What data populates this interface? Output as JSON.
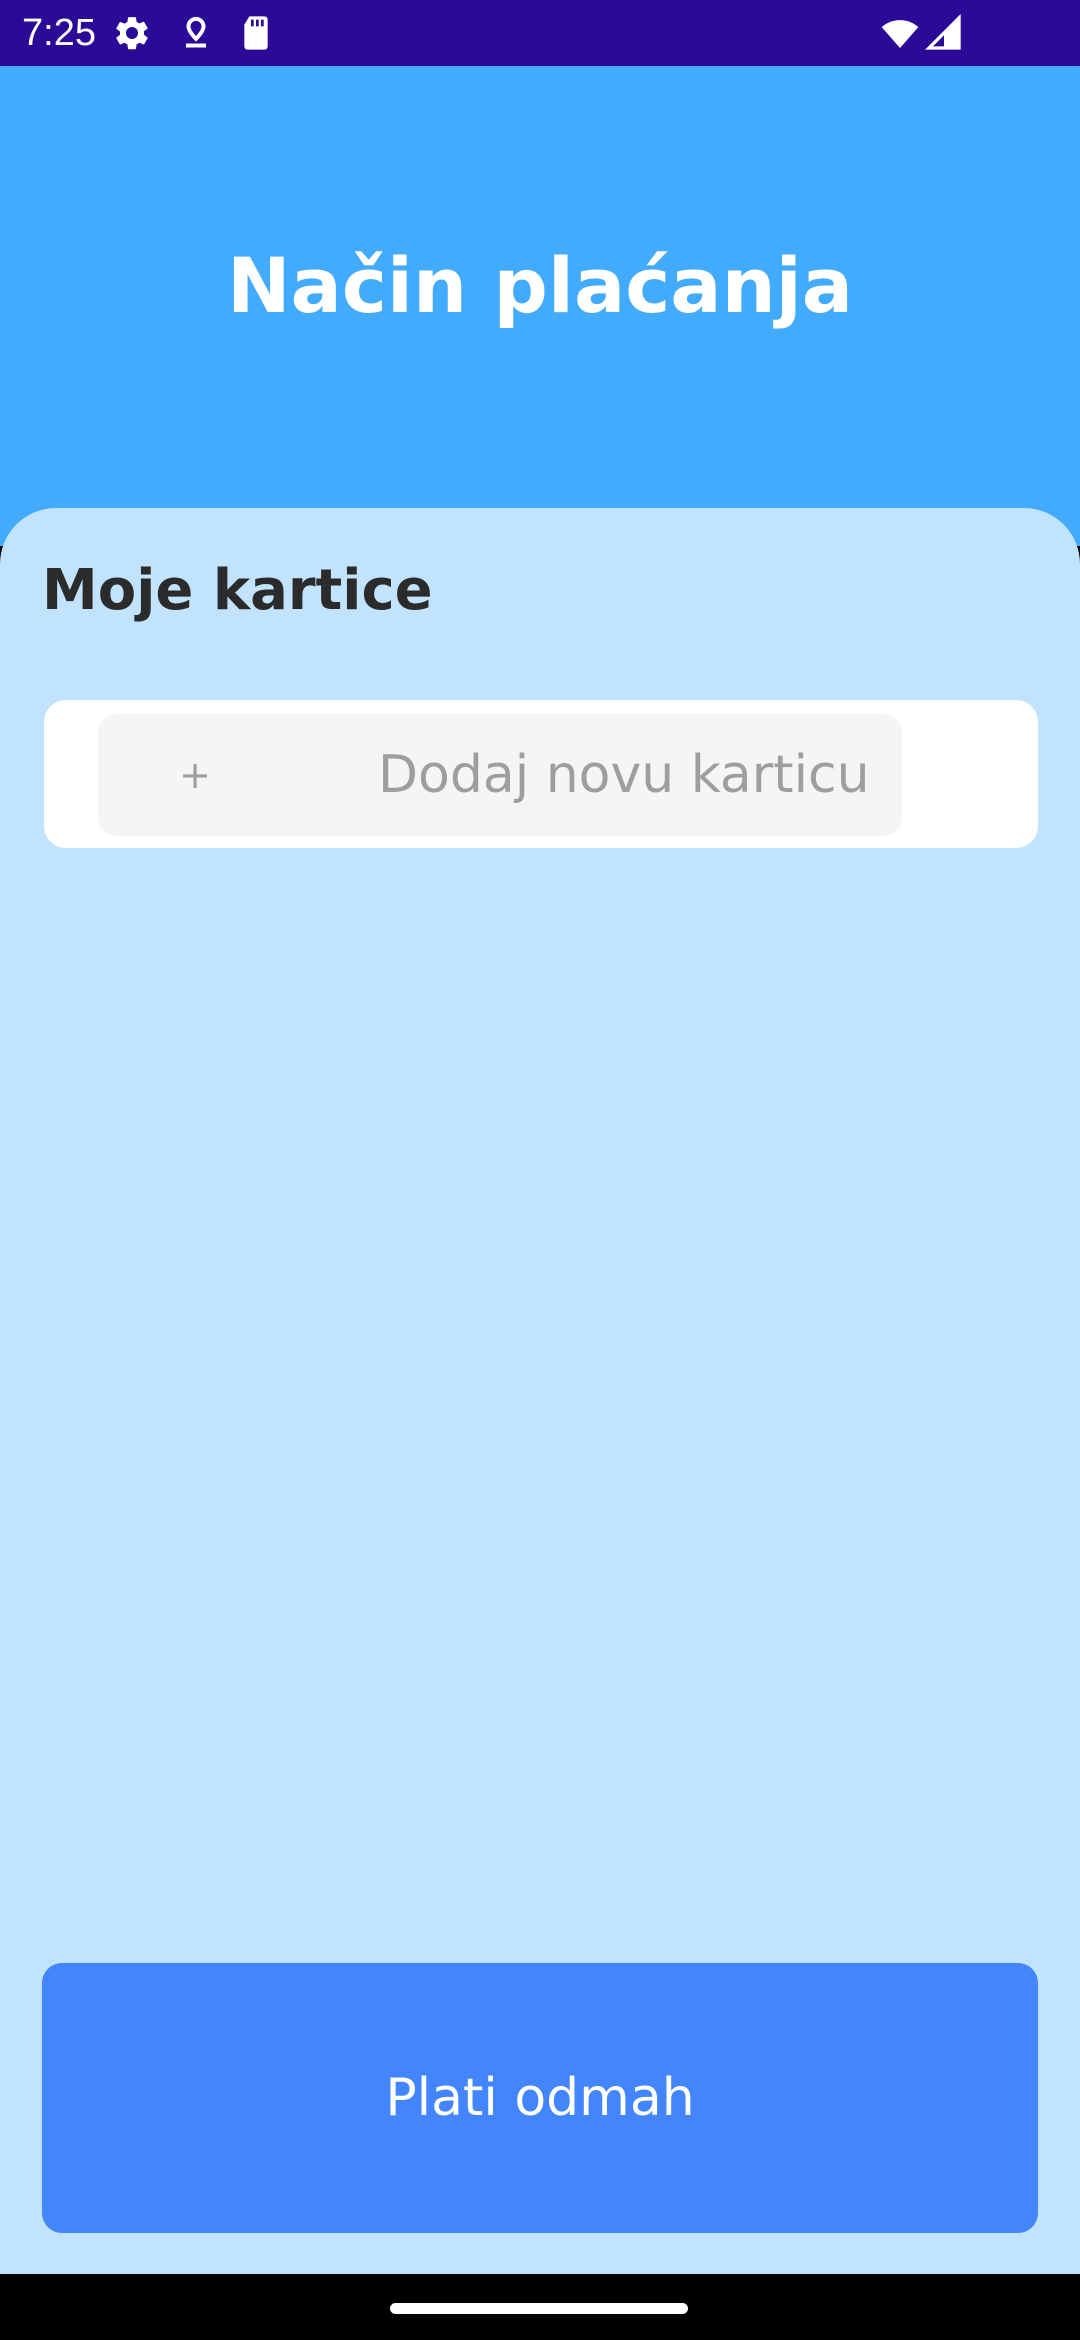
{
  "status_bar": {
    "time": "7:25",
    "icons": [
      "settings-gear-icon",
      "location-pin-icon",
      "sd-card-icon",
      "wifi-icon",
      "cell-signal-icon"
    ]
  },
  "header": {
    "title": "Način plaćanja",
    "background_color": "#43abfd"
  },
  "content": {
    "section_title": "Moje kartice",
    "add_card": {
      "icon": "+",
      "label": "Dodaj novu karticu"
    },
    "background_color": "#c2e3fd"
  },
  "pay_button": {
    "label": "Plati odmah",
    "color": "#4385fc"
  }
}
